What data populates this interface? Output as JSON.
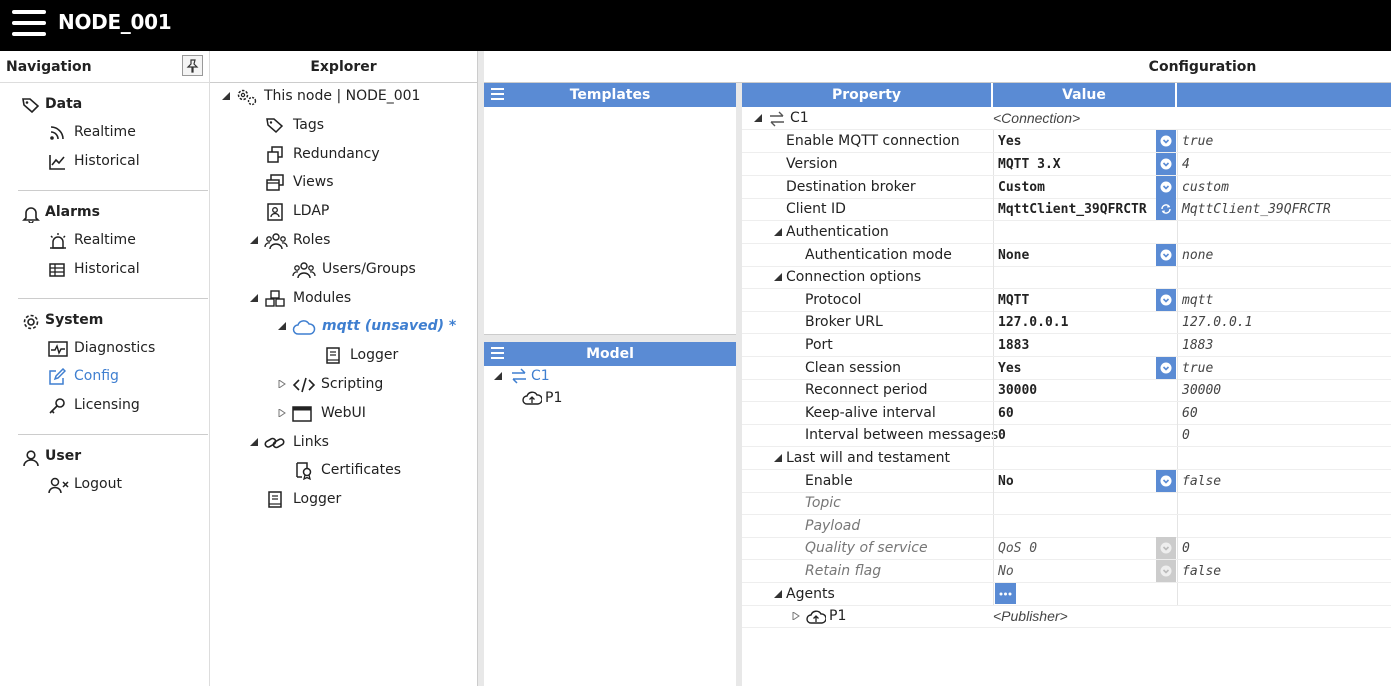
{
  "app": {
    "title": "NODE_001"
  },
  "nav": {
    "title": "Navigation",
    "groups": [
      {
        "label": "Data",
        "items": [
          {
            "label": "Realtime"
          },
          {
            "label": "Historical"
          }
        ]
      },
      {
        "label": "Alarms",
        "items": [
          {
            "label": "Realtime"
          },
          {
            "label": "Historical"
          }
        ]
      },
      {
        "label": "System",
        "items": [
          {
            "label": "Diagnostics"
          },
          {
            "label": "Config"
          },
          {
            "label": "Licensing"
          }
        ]
      },
      {
        "label": "User",
        "items": [
          {
            "label": "Logout"
          }
        ]
      }
    ]
  },
  "explorer": {
    "title": "Explorer",
    "items": [
      {
        "label": "This node | NODE_001"
      },
      {
        "label": "Tags"
      },
      {
        "label": "Redundancy"
      },
      {
        "label": "Views"
      },
      {
        "label": "LDAP"
      },
      {
        "label": "Roles"
      },
      {
        "label": "Users/Groups"
      },
      {
        "label": "Modules"
      },
      {
        "label": "mqtt (unsaved) *"
      },
      {
        "label": "Logger"
      },
      {
        "label": "Scripting"
      },
      {
        "label": "WebUI"
      },
      {
        "label": "Links"
      },
      {
        "label": "Certificates"
      },
      {
        "label": "Logger"
      }
    ]
  },
  "config": {
    "title": "Configuration",
    "templates_title": "Templates",
    "model_title": "Model",
    "model_items": [
      {
        "label": "C1"
      },
      {
        "label": "P1"
      }
    ],
    "columns": {
      "property": "Property",
      "value": "Value"
    },
    "rows": [
      {
        "prop": "C1",
        "val": "<Connection>",
        "raw": ""
      },
      {
        "prop": "Enable MQTT connection",
        "val": "Yes",
        "raw": "true"
      },
      {
        "prop": "Version",
        "val": "MQTT 3.X",
        "raw": "4"
      },
      {
        "prop": "Destination broker",
        "val": "Custom",
        "raw": "custom"
      },
      {
        "prop": "Client ID",
        "val": "MqttClient_39QFRCTR",
        "raw": "MqttClient_39QFRCTR"
      },
      {
        "prop": "Authentication",
        "val": "",
        "raw": ""
      },
      {
        "prop": "Authentication mode",
        "val": "None",
        "raw": "none"
      },
      {
        "prop": "Connection options",
        "val": "",
        "raw": ""
      },
      {
        "prop": "Protocol",
        "val": "MQTT",
        "raw": "mqtt"
      },
      {
        "prop": "Broker URL",
        "val": "127.0.0.1",
        "raw": "127.0.0.1"
      },
      {
        "prop": "Port",
        "val": "1883",
        "raw": "1883"
      },
      {
        "prop": "Clean session",
        "val": "Yes",
        "raw": "true"
      },
      {
        "prop": "Reconnect period",
        "val": "30000",
        "raw": "30000"
      },
      {
        "prop": "Keep-alive interval",
        "val": "60",
        "raw": "60"
      },
      {
        "prop": "Interval between messages",
        "val": "0",
        "raw": "0"
      },
      {
        "prop": "Last will and testament",
        "val": "",
        "raw": ""
      },
      {
        "prop": "Enable",
        "val": "No",
        "raw": "false"
      },
      {
        "prop": "Topic",
        "val": "",
        "raw": ""
      },
      {
        "prop": "Payload",
        "val": "",
        "raw": ""
      },
      {
        "prop": "Quality of service",
        "val": "QoS 0",
        "raw": "0"
      },
      {
        "prop": "Retain flag",
        "val": "No",
        "raw": "false"
      },
      {
        "prop": "Agents",
        "val": "",
        "raw": ""
      },
      {
        "prop": "P1",
        "val": "<Publisher>",
        "raw": ""
      }
    ]
  },
  "colors": {
    "accent": "#5a8bd4",
    "active": "#3f7fd0",
    "topbar": "#000000"
  }
}
